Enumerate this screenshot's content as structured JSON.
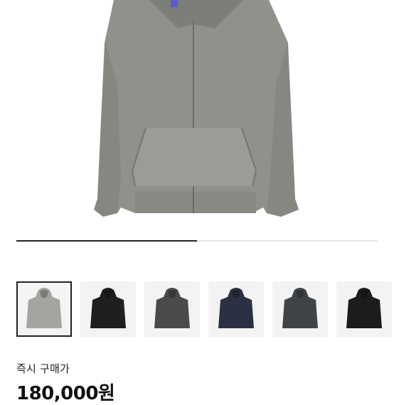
{
  "product": {
    "main_image": "gray-zip-up-hoodie-image",
    "image_slider": {
      "progress": 0.5
    },
    "thumbnails": [
      {
        "color": "#a3a59f",
        "selected": true
      },
      {
        "color": "#1f1f1f",
        "selected": false
      },
      {
        "color": "#4a4a4a",
        "selected": false
      },
      {
        "color": "#2b3142",
        "selected": false
      },
      {
        "color": "#3f4547",
        "selected": false
      },
      {
        "color": "#1c1c1c",
        "selected": false
      }
    ],
    "price_label": "즉시 구매가",
    "price": "180,000원"
  }
}
